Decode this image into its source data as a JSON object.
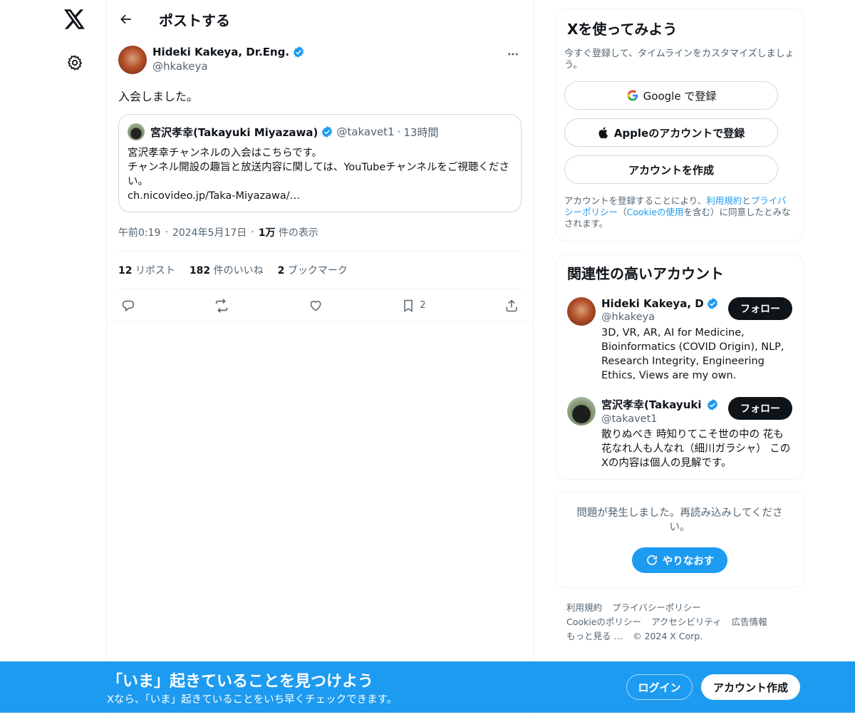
{
  "colors": {
    "accent": "#1d9bf0",
    "text": "#0f1419",
    "muted": "#536471",
    "verified": "#1d9bf0"
  },
  "rail": {
    "logo_icon": "x-logo-icon",
    "settings_icon": "gear-icon"
  },
  "header": {
    "title": "ポストする"
  },
  "post": {
    "author_name": "Hideki Kakeya, Dr.Eng.",
    "author_handle": "@hkakeya",
    "text": "入会しました。",
    "quote": {
      "name": "宮沢孝幸(Takayuki Miyazawa)",
      "handle": "@takavet1",
      "dot": "·",
      "time": "13時間",
      "line1": "宮沢孝幸チャンネルの入会はこちらです。",
      "line2": "チャンネル開設の趣旨と放送内容に関しては、YouTubeチャンネルをご視聴ください。",
      "line3": "ch.nicovideo.jp/Taka-Miyazawa/…"
    },
    "timestamp": {
      "time": "午前0:19",
      "date": "2024年5月17日",
      "views_count": "1万",
      "views_label": "件の表示",
      "sep": "·"
    },
    "stats": {
      "reposts_count": "12",
      "reposts_label": "リポスト",
      "likes_count": "182",
      "likes_label": "件のいいね",
      "bookmarks_count": "2",
      "bookmarks_label": "ブックマーク"
    },
    "actions": {
      "bookmark_count": "2"
    }
  },
  "signup": {
    "title": "Xを使ってみよう",
    "subtitle": "今すぐ登録して、タイムラインをカスタマイズしましょう。",
    "google_label": "Google で登録",
    "apple_label": "Appleのアカウントで登録",
    "create_label": "アカウントを作成",
    "legal_pre": "アカウントを登録することにより、",
    "legal_terms": "利用規約",
    "legal_and": "と",
    "legal_privacy": "プライバシーポリシー",
    "legal_mid": "（",
    "legal_cookie": "Cookieの使用",
    "legal_post": "を含む）に同意したとみなされます。"
  },
  "related": {
    "title": "関連性の高いアカウント",
    "follow_label": "フォロー",
    "accounts": [
      {
        "name": "Hideki Kakeya, Dr.Eng.",
        "handle": "@hkakeya",
        "bio": "3D, VR, AR, AI for Medicine, Bioinformatics (COVID Origin), NLP, Research Integrity, Engineering Ethics, Views are my own."
      },
      {
        "name": "宮沢孝幸(Takayuki Miyazawa)",
        "handle": "@takavet1",
        "bio": "散りぬべき 時知りてこそ世の中の 花も花なれ人も人なれ（細川ガラシャ） このXの内容は個人の見解です。"
      }
    ]
  },
  "error": {
    "text": "問題が発生しました。再読み込みしてください。",
    "retry_label": "やりなおす"
  },
  "footer": {
    "terms": "利用規約",
    "privacy": "プライバシーポリシー",
    "cookie": "Cookieのポリシー",
    "accessibility": "アクセシビリティ",
    "ads": "広告情報",
    "more": "もっと見る …",
    "copyright": "© 2024 X Corp."
  },
  "banner": {
    "title": "「いま」起きていることを見つけよう",
    "subtitle": "Xなら、「いま」起きていることをいち早くチェックできます。",
    "login_label": "ログイン",
    "signup_label": "アカウント作成"
  }
}
